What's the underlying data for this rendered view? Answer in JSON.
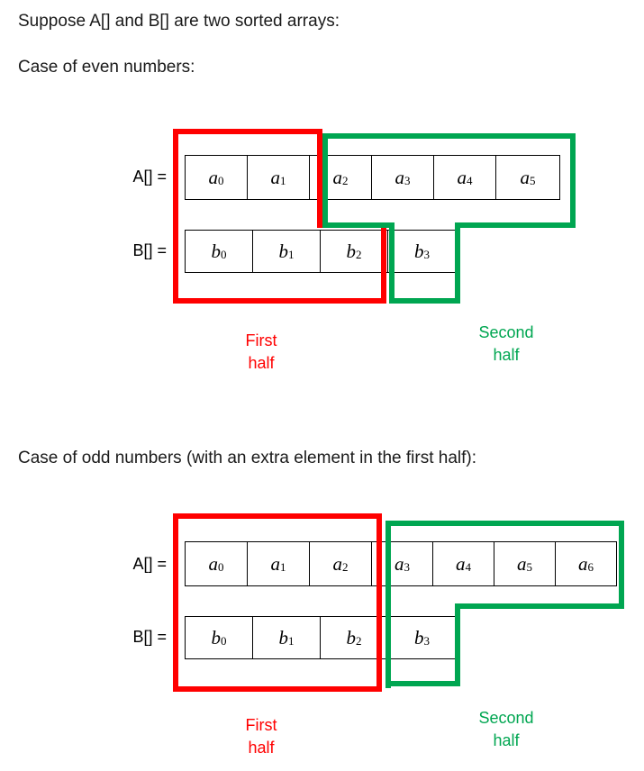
{
  "page": {
    "intro": "Suppose A[] and B[] are two sorted arrays:",
    "even_case_heading": "Case of even numbers:",
    "odd_case_heading": "Case of odd numbers (with an extra element in the first half):"
  },
  "colors": {
    "first_half": "#ff0000",
    "second_half": "#00a651",
    "cell_border": "#000000",
    "text": "#000000",
    "background": "#ffffff"
  },
  "labels": {
    "array_a": "A[] =",
    "array_b": "B[] =",
    "first_half_line1": "First",
    "first_half_line2": "half",
    "second_half_line1": "Second",
    "second_half_line2": "half"
  },
  "even_case": {
    "array_a": {
      "name": "A[]",
      "cells": [
        {
          "base": "a",
          "index": "0"
        },
        {
          "base": "a",
          "index": "1"
        },
        {
          "base": "a",
          "index": "2"
        },
        {
          "base": "a",
          "index": "3"
        },
        {
          "base": "a",
          "index": "4"
        },
        {
          "base": "a",
          "index": "5"
        }
      ],
      "first_half_count": 2,
      "second_half_count": 4
    },
    "array_b": {
      "name": "B[]",
      "cells": [
        {
          "base": "b",
          "index": "0"
        },
        {
          "base": "b",
          "index": "1"
        },
        {
          "base": "b",
          "index": "2"
        },
        {
          "base": "b",
          "index": "3"
        }
      ],
      "first_half_count": 3,
      "second_half_count": 1
    },
    "total_first_half": 5,
    "total_second_half": 5
  },
  "odd_case": {
    "array_a": {
      "name": "A[]",
      "cells": [
        {
          "base": "a",
          "index": "0"
        },
        {
          "base": "a",
          "index": "1"
        },
        {
          "base": "a",
          "index": "2"
        },
        {
          "base": "a",
          "index": "3"
        },
        {
          "base": "a",
          "index": "4"
        },
        {
          "base": "a",
          "index": "5"
        },
        {
          "base": "a",
          "index": "6"
        }
      ],
      "first_half_count": 3,
      "second_half_count": 4
    },
    "array_b": {
      "name": "B[]",
      "cells": [
        {
          "base": "b",
          "index": "0"
        },
        {
          "base": "b",
          "index": "1"
        },
        {
          "base": "b",
          "index": "2"
        },
        {
          "base": "b",
          "index": "3"
        }
      ],
      "first_half_count": 3,
      "second_half_count": 1
    },
    "total_first_half": 6,
    "total_second_half": 5
  }
}
